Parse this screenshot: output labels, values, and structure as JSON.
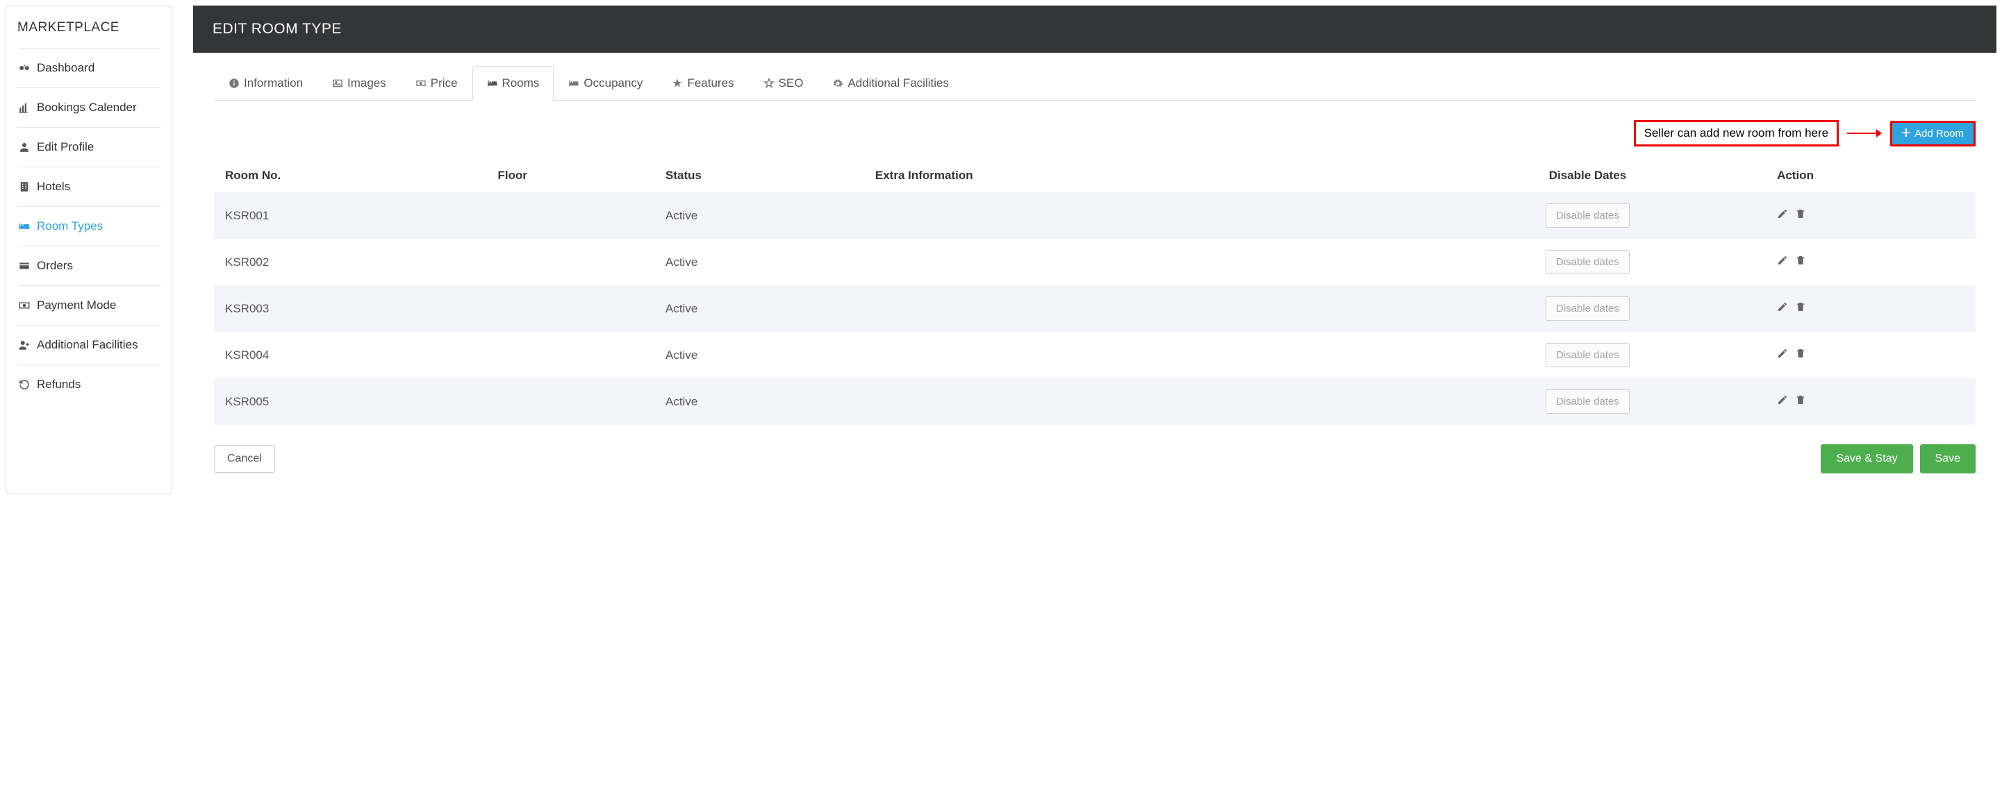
{
  "sidebar": {
    "title": "MARKETPLACE",
    "items": [
      {
        "label": "Dashboard"
      },
      {
        "label": "Bookings Calender"
      },
      {
        "label": "Edit Profile"
      },
      {
        "label": "Hotels"
      },
      {
        "label": "Room Types"
      },
      {
        "label": "Orders"
      },
      {
        "label": "Payment Mode"
      },
      {
        "label": "Additional Facilities"
      },
      {
        "label": "Refunds"
      }
    ]
  },
  "header": {
    "title": "EDIT ROOM TYPE"
  },
  "tabs": [
    {
      "label": "Information"
    },
    {
      "label": "Images"
    },
    {
      "label": "Price"
    },
    {
      "label": "Rooms"
    },
    {
      "label": "Occupancy"
    },
    {
      "label": "Features"
    },
    {
      "label": "SEO"
    },
    {
      "label": "Additional Facilities"
    }
  ],
  "annotation": {
    "text": "Seller can add new room from here"
  },
  "toolbar": {
    "add_room_label": "Add Room"
  },
  "table": {
    "columns": {
      "room_no": "Room No.",
      "floor": "Floor",
      "status": "Status",
      "extra": "Extra Information",
      "disable": "Disable Dates",
      "action": "Action"
    },
    "rows": [
      {
        "room_no": "KSR001",
        "floor": "",
        "status": "Active",
        "extra": "",
        "disable_btn": "Disable dates"
      },
      {
        "room_no": "KSR002",
        "floor": "",
        "status": "Active",
        "extra": "",
        "disable_btn": "Disable dates"
      },
      {
        "room_no": "KSR003",
        "floor": "",
        "status": "Active",
        "extra": "",
        "disable_btn": "Disable dates"
      },
      {
        "room_no": "KSR004",
        "floor": "",
        "status": "Active",
        "extra": "",
        "disable_btn": "Disable dates"
      },
      {
        "room_no": "KSR005",
        "floor": "",
        "status": "Active",
        "extra": "",
        "disable_btn": "Disable dates"
      }
    ]
  },
  "footer": {
    "cancel_label": "Cancel",
    "save_stay_label": "Save & Stay",
    "save_label": "Save"
  }
}
